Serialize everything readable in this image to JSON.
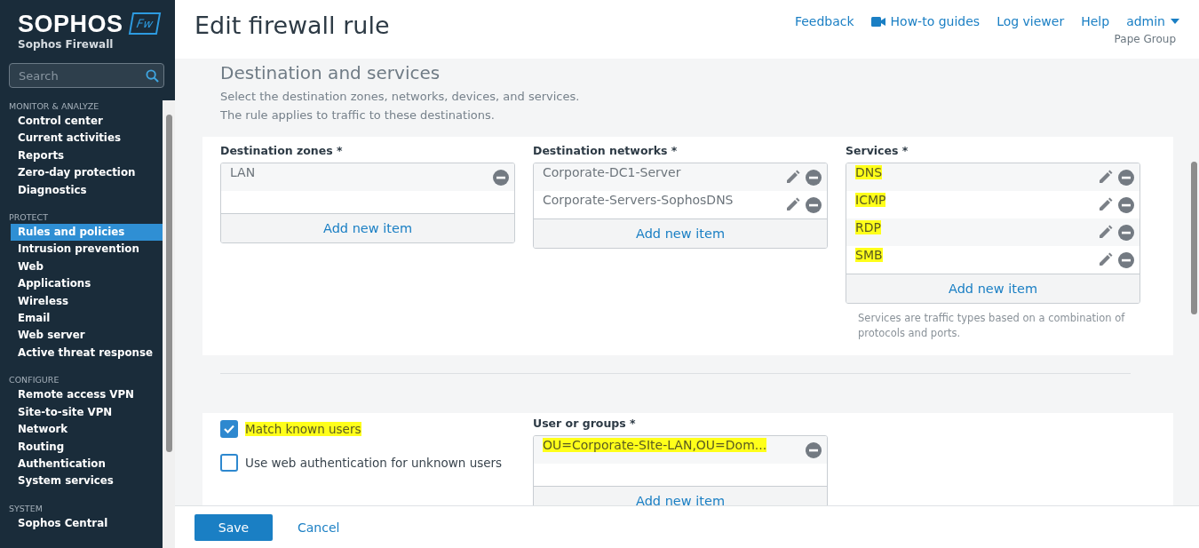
{
  "brand": {
    "name": "SOPHOS",
    "badge": "Fw",
    "product": "Sophos Firewall"
  },
  "search": {
    "placeholder": "Search"
  },
  "sidebar": {
    "sections": [
      {
        "label": "MONITOR & ANALYZE",
        "items": [
          {
            "label": "Control center",
            "selected": false
          },
          {
            "label": "Current activities",
            "selected": false
          },
          {
            "label": "Reports",
            "selected": false
          },
          {
            "label": "Zero-day protection",
            "selected": false
          },
          {
            "label": "Diagnostics",
            "selected": false
          }
        ]
      },
      {
        "label": "PROTECT",
        "items": [
          {
            "label": "Rules and policies",
            "selected": true
          },
          {
            "label": "Intrusion prevention",
            "selected": false
          },
          {
            "label": "Web",
            "selected": false
          },
          {
            "label": "Applications",
            "selected": false
          },
          {
            "label": "Wireless",
            "selected": false
          },
          {
            "label": "Email",
            "selected": false
          },
          {
            "label": "Web server",
            "selected": false
          },
          {
            "label": "Active threat response",
            "selected": false
          }
        ]
      },
      {
        "label": "CONFIGURE",
        "items": [
          {
            "label": "Remote access VPN",
            "selected": false
          },
          {
            "label": "Site-to-site VPN",
            "selected": false
          },
          {
            "label": "Network",
            "selected": false
          },
          {
            "label": "Routing",
            "selected": false
          },
          {
            "label": "Authentication",
            "selected": false
          },
          {
            "label": "System services",
            "selected": false
          }
        ]
      },
      {
        "label": "SYSTEM",
        "items": [
          {
            "label": "Sophos Central",
            "selected": false
          }
        ]
      }
    ]
  },
  "page_title": "Edit firewall rule",
  "top_links": [
    {
      "label": "Feedback",
      "kind": "link"
    },
    {
      "label": "How-to guides",
      "kind": "video"
    },
    {
      "label": "Log viewer",
      "kind": "link"
    },
    {
      "label": "Help",
      "kind": "link"
    },
    {
      "label": "admin",
      "kind": "menu"
    }
  ],
  "organization": "Pape Group",
  "section": {
    "title": "Destination and services",
    "description": [
      "Select the destination zones, networks, devices, and services.",
      "The rule applies to traffic to these destinations."
    ]
  },
  "lists": [
    {
      "label": "Destination zones *",
      "editable": false,
      "items": [
        {
          "text": "LAN",
          "highlighted": false
        }
      ],
      "add": "Add new item"
    },
    {
      "label": "Destination networks *",
      "editable": true,
      "items": [
        {
          "text": "Corporate-DC1-Server",
          "highlighted": false
        },
        {
          "text": "Corporate-Servers-SophosDNS",
          "highlighted": false
        }
      ],
      "add": "Add new item"
    },
    {
      "label": "Services *",
      "editable": true,
      "items": [
        {
          "text": "DNS",
          "highlighted": true
        },
        {
          "text": "ICMP",
          "highlighted": true
        },
        {
          "text": "RDP",
          "highlighted": true
        },
        {
          "text": "SMB",
          "highlighted": true
        }
      ],
      "add": "Add new item",
      "hint": "Services are traffic types based on a combination of protocols and ports."
    }
  ],
  "options": [
    {
      "label": "Match known users",
      "checked": true,
      "highlighted": true
    },
    {
      "label": "Use web authentication for unknown users",
      "checked": false,
      "highlighted": false
    }
  ],
  "users": {
    "label": "User or groups *",
    "items": [
      {
        "text": "OU=Corporate-SIte-LAN,OU=Dom...",
        "highlighted": true
      }
    ],
    "add": "Add new item"
  },
  "buttons": [
    {
      "label": "Save",
      "kind": "primary"
    },
    {
      "label": "Cancel",
      "kind": "link"
    }
  ]
}
